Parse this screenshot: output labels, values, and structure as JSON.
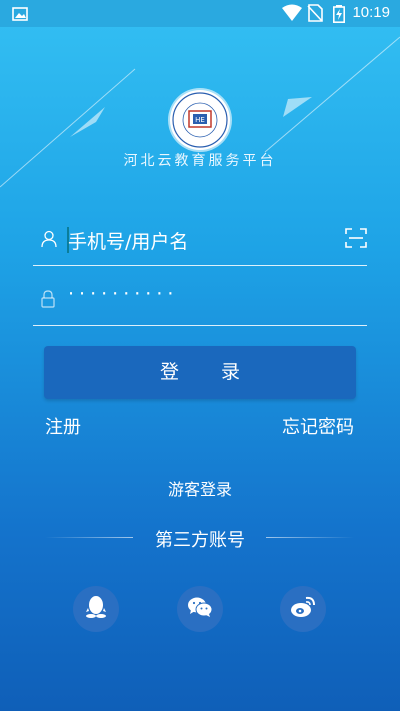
{
  "status_bar": {
    "time": "10:19",
    "icons": [
      "image-icon",
      "wifi-icon",
      "no-sim-icon",
      "battery-charging-icon"
    ]
  },
  "app": {
    "name": "河北云教育服务平台",
    "logo_text": "职业技术人才知识服务工程"
  },
  "login_form": {
    "username_placeholder": "手机号/用户名",
    "password_mask": "··········",
    "login_label": "登 录"
  },
  "links": {
    "register": "注册",
    "forgot_password": "忘记密码",
    "guest_login": "游客登录"
  },
  "third_party": {
    "title": "第三方账号",
    "providers": [
      "qq-icon",
      "wechat-icon",
      "weibo-icon"
    ]
  },
  "colors": {
    "bg_top": "#34c0f3",
    "bg_bottom": "#0f5fb8",
    "button": "#1a68bd",
    "social_bg": "#2a6fc2"
  }
}
